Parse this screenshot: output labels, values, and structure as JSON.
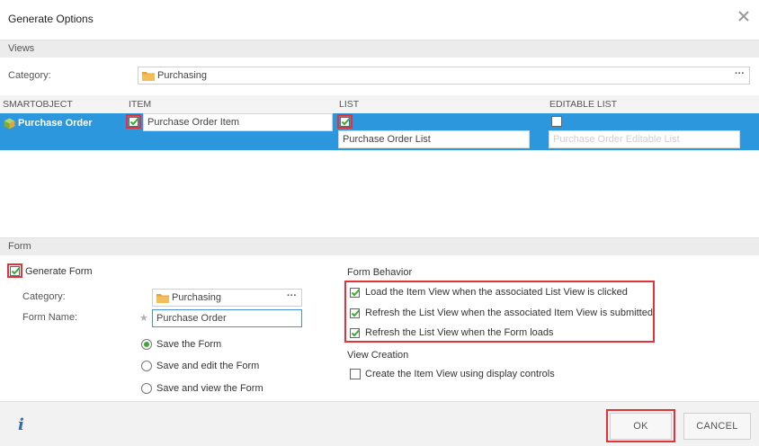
{
  "dialog": {
    "title": "Generate Options"
  },
  "views": {
    "section_label": "Views",
    "category_label": "Category:",
    "category_value": "Purchasing",
    "picker_button": "···",
    "columns": {
      "smartobject": "SMARTOBJECT",
      "item": "ITEM",
      "list": "LIST",
      "editable_list": "EDITABLE LIST"
    },
    "row": {
      "smartobject": "Purchase Order",
      "item_name": "Purchase Order Item",
      "item_checked": true,
      "list_name": "Purchase Order List",
      "list_checked": true,
      "editable_list_placeholder": "Purchase Order Editable List",
      "editable_list_checked": false
    }
  },
  "form": {
    "section_label": "Form",
    "generate_label": "Generate Form",
    "generate_checked": true,
    "category_label": "Category:",
    "category_value": "Purchasing",
    "picker_button": "···",
    "name_label": "Form Name:",
    "name_value": "Purchase Order",
    "save_options": [
      {
        "label": "Save the Form",
        "selected": true
      },
      {
        "label": "Save and edit the Form",
        "selected": false
      },
      {
        "label": "Save and view the Form",
        "selected": false
      }
    ],
    "behavior_heading": "Form Behavior",
    "behaviors": [
      {
        "label": "Load the Item View when the associated List View is clicked",
        "checked": true
      },
      {
        "label": "Refresh the List View when the associated Item View is submitted",
        "checked": true
      },
      {
        "label": "Refresh the List View when the Form loads",
        "checked": true
      }
    ],
    "view_creation_heading": "View Creation",
    "view_creation_option": {
      "label": "Create the Item View using display controls",
      "checked": false
    }
  },
  "footer": {
    "info": "i",
    "ok": "OK",
    "cancel": "CANCEL"
  },
  "colors": {
    "selection": "#2d97de",
    "highlight": "#e53238",
    "check": "#3aaa35"
  }
}
